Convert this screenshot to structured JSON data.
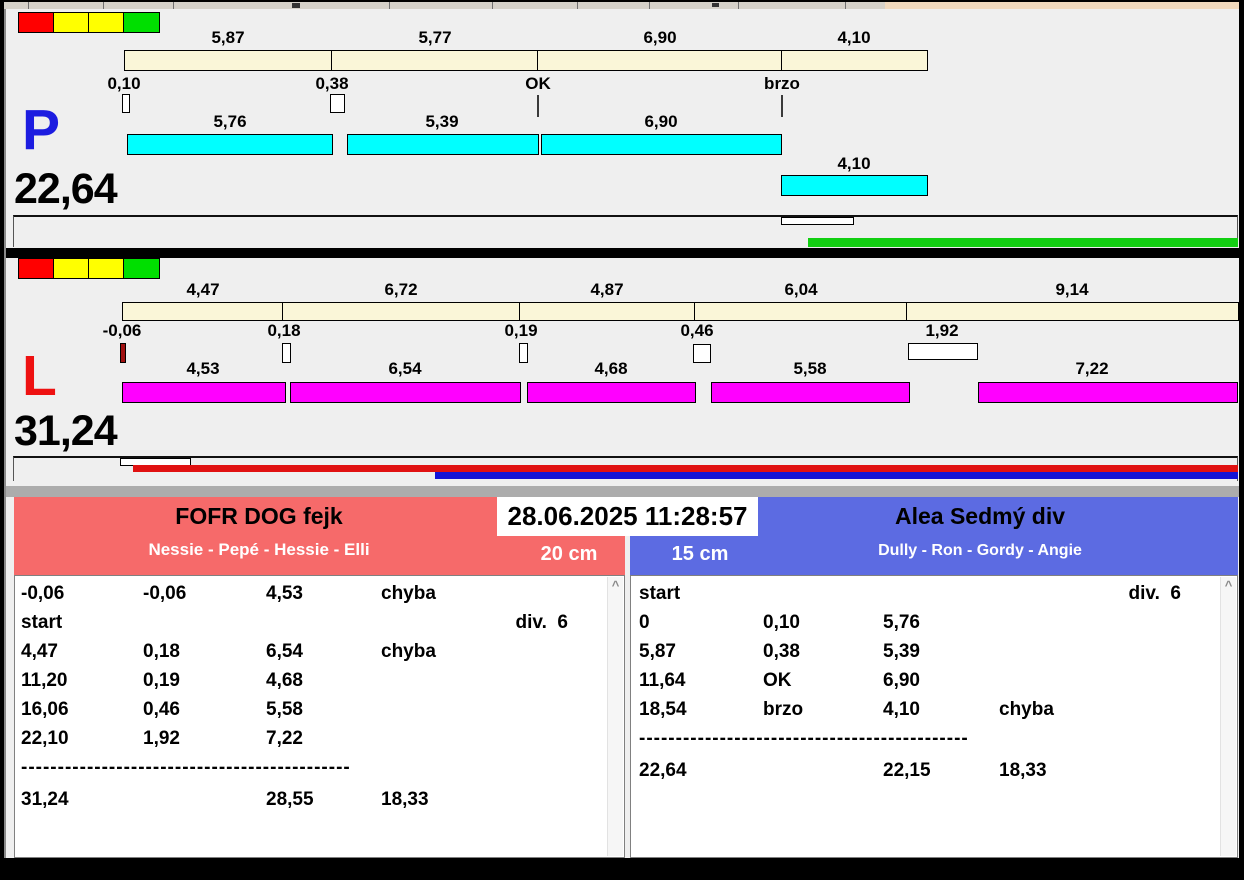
{
  "colors": {
    "cream": "#FAF6D8",
    "cyan": "#00FFFF",
    "magenta": "#FF00FF",
    "green_bar": "#12CF12",
    "red_bar": "#E01111",
    "blue_bar": "#1414D6",
    "team_red": "#F66A6A",
    "team_blue": "#5C6BE2",
    "p_letter": "#1C1CE0",
    "l_letter": "#EE1111",
    "status_red": "#FF0000",
    "status_yellow": "#FFFF00",
    "status_green": "#00DF00",
    "toolbar_accent": "#F0D9BD"
  },
  "icons": {
    "scroll_up": "^"
  },
  "timestamp": "28.06.2025 11:28:57",
  "track_p": {
    "label": "P",
    "total": "22,64",
    "plan": [
      "5,87",
      "5,77",
      "6,90",
      "4,10"
    ],
    "marks": [
      "0,10",
      "0,38",
      "OK",
      "brzo"
    ],
    "run": [
      "5,76",
      "5,39",
      "6,90"
    ],
    "late": "4,10"
  },
  "track_l": {
    "label": "L",
    "total": "31,24",
    "plan": [
      "4,47",
      "6,72",
      "4,87",
      "6,04",
      "9,14"
    ],
    "marks": [
      "-0,06",
      "0,18",
      "0,19",
      "0,46",
      "1,92"
    ],
    "run": [
      "4,53",
      "6,54",
      "4,68",
      "5,58",
      "7,22"
    ]
  },
  "left_panel": {
    "team": "FOFR DOG fejk",
    "dogs": "Nessie - Pepé - Hessie - Elli",
    "height": "20 cm",
    "rows": [
      [
        "-0,06",
        "-0,06",
        "4,53",
        "chyba",
        ""
      ],
      [
        "start",
        "",
        "",
        "",
        "div.  6"
      ],
      [
        "4,47",
        "0,18",
        "6,54",
        "chyba",
        ""
      ],
      [
        "11,20",
        "0,19",
        "4,68",
        "",
        ""
      ],
      [
        "16,06",
        "0,46",
        "5,58",
        "",
        ""
      ],
      [
        "22,10",
        "1,92",
        "7,22",
        "",
        ""
      ]
    ],
    "separator": "---------------------------------------------",
    "total_row": [
      "31,24",
      "",
      "28,55",
      "18,33",
      ""
    ]
  },
  "right_panel": {
    "team": "Alea Sedmý div",
    "dogs": "Dully - Ron - Gordy - Angie",
    "height": "15 cm",
    "rows": [
      [
        "start",
        "",
        "",
        "",
        "div.  6"
      ],
      [
        "0",
        "0,10",
        "5,76",
        "",
        ""
      ],
      [
        "5,87",
        "0,38",
        "5,39",
        "",
        ""
      ],
      [
        "11,64",
        "OK",
        "6,90",
        "",
        ""
      ],
      [
        "18,54",
        "brzo",
        "4,10",
        "chyba",
        ""
      ]
    ],
    "separator": "---------------------------------------------",
    "total_row": [
      "22,64",
      "",
      "22,15",
      "18,33",
      ""
    ]
  }
}
